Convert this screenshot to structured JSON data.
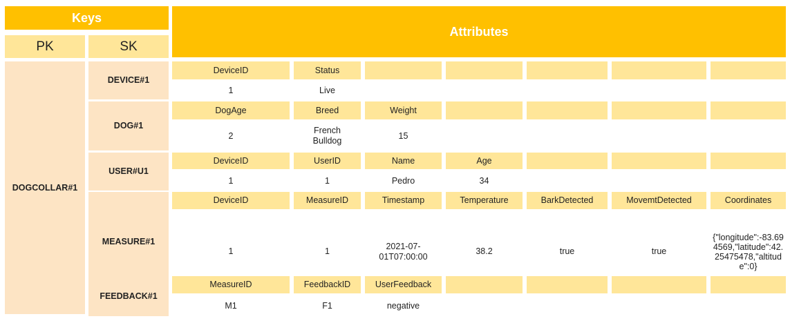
{
  "headers": {
    "keys": "Keys",
    "attributes": "Attributes",
    "pk": "PK",
    "sk": "SK"
  },
  "pk_value": "DOGCOLLAR#1",
  "groups": [
    {
      "sk": "DEVICE#1",
      "names": [
        "DeviceID",
        "Status",
        "",
        "",
        "",
        "",
        ""
      ],
      "values": [
        "1",
        "Live",
        "",
        "",
        "",
        "",
        ""
      ]
    },
    {
      "sk": "DOG#1",
      "names": [
        "DogAge",
        "Breed",
        "Weight",
        "",
        "",
        "",
        ""
      ],
      "values": [
        "2",
        "French Bulldog",
        "15",
        "",
        "",
        "",
        ""
      ]
    },
    {
      "sk": "USER#U1",
      "names": [
        "DeviceID",
        "UserID",
        "Name",
        "Age",
        "",
        "",
        ""
      ],
      "values": [
        "1",
        "1",
        "Pedro",
        "34",
        "",
        "",
        ""
      ]
    },
    {
      "sk": "MEASURE#1",
      "names": [
        "DeviceID",
        "MeasureID",
        "Timestamp",
        "Temperature",
        "BarkDetected",
        "MovemtDetected",
        "Coordinates"
      ],
      "values": [
        "1",
        "1",
        "2021-07-01T07:00:00",
        "38.2",
        "true",
        "true",
        "{\"longitude\":-83.694569,\"latitude\":42.25475478,\"altitude\":0}"
      ]
    },
    {
      "sk": "FEEDBACK#1",
      "names": [
        "MeasureID",
        "FeedbackID",
        "UserFeedback",
        "",
        "",
        "",
        ""
      ],
      "values": [
        "M1",
        "F1",
        "negative",
        "",
        "",
        "",
        ""
      ]
    }
  ]
}
